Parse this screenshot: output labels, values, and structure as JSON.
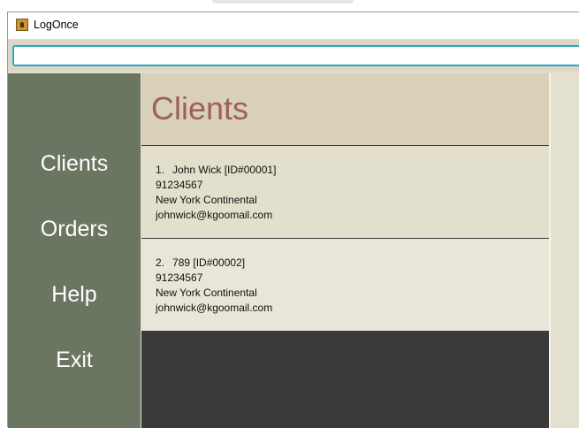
{
  "window": {
    "title": "LogOnce"
  },
  "command": {
    "value": "",
    "placeholder": ""
  },
  "sidebar": {
    "items": [
      {
        "label": "Clients"
      },
      {
        "label": "Orders"
      },
      {
        "label": "Help"
      },
      {
        "label": "Exit"
      }
    ]
  },
  "main": {
    "title": "Clients",
    "clients": [
      {
        "index": "1.",
        "name_id": "John Wick [ID#00001]",
        "phone": "91234567",
        "address": "New York Continental",
        "email": "johnwick@kgoomail.com"
      },
      {
        "index": "2.",
        "name_id": "789 [ID#00002]",
        "phone": "91234567",
        "address": "New York Continental",
        "email": "johnwick@kgoomail.com"
      }
    ]
  },
  "colors": {
    "sidebar": "#6b7662",
    "header": "#d8d0b8",
    "title_text": "#9e5f5b",
    "input_border": "#2aa6c9",
    "list_background": "#3a3a3a"
  }
}
